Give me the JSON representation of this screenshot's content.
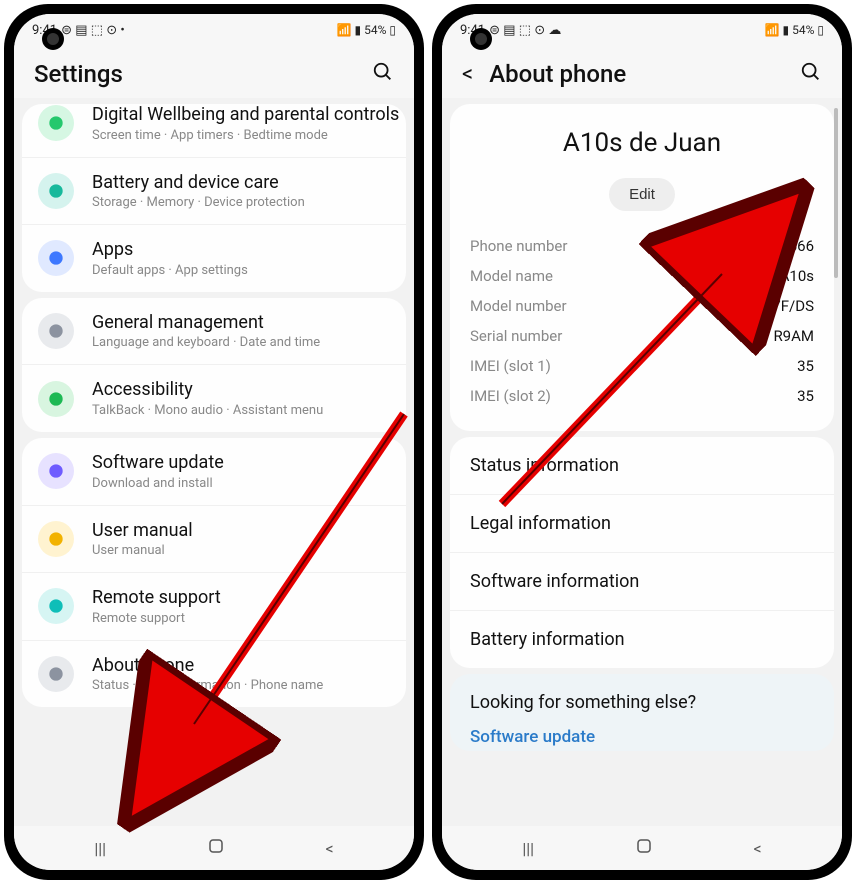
{
  "status": {
    "time": "9:41",
    "battery": "54%"
  },
  "left": {
    "header": "Settings",
    "items": [
      {
        "iconColor": "#25c86d",
        "iconBg": "#d6f7e3",
        "title": "Digital Wellbeing and parental controls",
        "sub": "Screen time · App timers · Bedtime mode",
        "clipTop": true
      },
      {
        "iconColor": "#18b99c",
        "iconBg": "#d5f3ee",
        "title": "Battery and device care",
        "sub": "Storage · Memory · Device protection"
      },
      {
        "iconColor": "#3d78ff",
        "iconBg": "#e0e9ff",
        "title": "Apps",
        "sub": "Default apps · App settings",
        "gapAfter": true
      },
      {
        "iconColor": "#8c93a0",
        "iconBg": "#e8eaed",
        "title": "General management",
        "sub": "Language and keyboard · Date and time"
      },
      {
        "iconColor": "#1db954",
        "iconBg": "#d8f5e0",
        "title": "Accessibility",
        "sub": "TalkBack · Mono audio · Assistant menu",
        "gapAfter": true
      },
      {
        "iconColor": "#6f5cff",
        "iconBg": "#e7e2ff",
        "title": "Software update",
        "sub": "Download and install"
      },
      {
        "iconColor": "#f2b200",
        "iconBg": "#fff3d0",
        "title": "User manual",
        "sub": "User manual"
      },
      {
        "iconColor": "#0fbeb8",
        "iconBg": "#d6f5f3",
        "title": "Remote support",
        "sub": "Remote support"
      },
      {
        "iconColor": "#8c93a0",
        "iconBg": "#e8eaed",
        "title": "About phone",
        "sub": "Status · Legal information · Phone name"
      }
    ]
  },
  "right": {
    "header": "About phone",
    "deviceName": "A10s de Juan",
    "editLabel": "Edit",
    "info": [
      {
        "label": "Phone number",
        "value": "+34666666666"
      },
      {
        "label": "Model name",
        "value": "Galaxy A10s"
      },
      {
        "label": "Model number",
        "value": "SM-A107F/DS"
      },
      {
        "label": "Serial number",
        "value": "R9AM"
      },
      {
        "label": "IMEI (slot 1)",
        "value": "35"
      },
      {
        "label": "IMEI (slot 2)",
        "value": "35"
      }
    ],
    "links": [
      "Status information",
      "Legal information",
      "Software information",
      "Battery information"
    ],
    "looking": {
      "title": "Looking for something else?",
      "link": "Software update"
    }
  }
}
